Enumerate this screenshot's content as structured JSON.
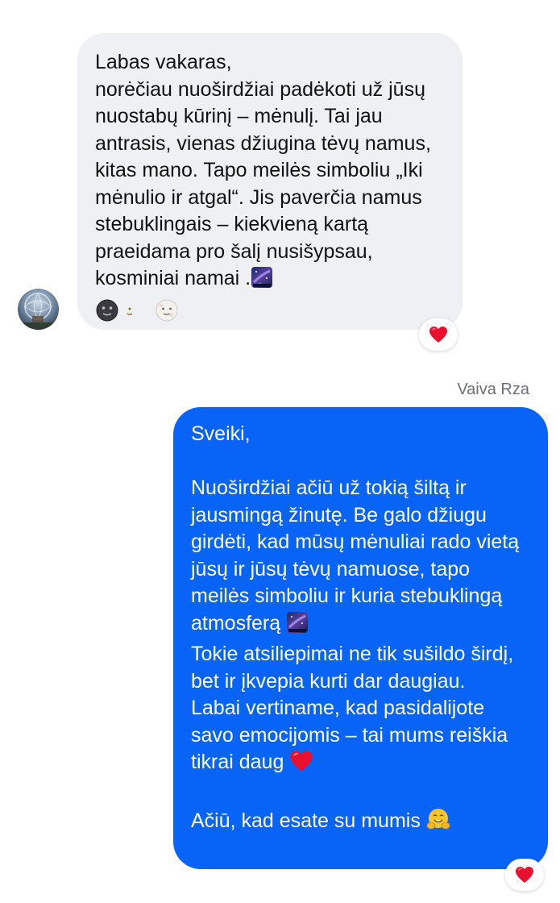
{
  "conversation": {
    "incoming": {
      "text": "Labas vakaras,\nnorėčiau nuoširdžiai padėkoti už jūsų nuostabų kūrinį – mėnulį. Tai jau antrasis, vienas džiugina tėvų namus, kitas mano. Tapo meilės simboliu „Iki mėnulio ir atgal“. Jis paverčia namus stebuklingais – kiekvieną kartą praeidama pro šalį nusišypsau, kosminiai namai .",
      "emojis": [
        "milky-way-icon",
        "new-moon-face-icon",
        "crescent-moon-icon",
        "full-moon-face-icon"
      ],
      "reaction": "red-heart-icon"
    },
    "outgoing": {
      "sender_name": "Vaiva Rza",
      "greeting": "Sveiki,",
      "paragraph_1": "Nuoširdžiai ačiū už tokią šiltą ir jausmingą žinutę. Be galo džiugu girdėti, kad mūsų mėnuliai rado vietą jūsų ir jūsų tėvų namuose, tapo meilės simboliu ir kuria stebuklingą atmosferą",
      "paragraph_2": "Tokie atsiliepimai ne tik sušildo širdį, bet ir įkvepia kurti dar daugiau.",
      "paragraph_3": "Labai vertiname, kad pasidalijote savo emocijomis – tai mums reiškia tikrai daug",
      "closing": "Ačiū, kad esate su mumis",
      "reaction": "red-heart-icon"
    }
  },
  "colors": {
    "incoming_bubble": "#eff0f4",
    "outgoing_bubble": "#0863f7",
    "heart": "#e8102e"
  }
}
